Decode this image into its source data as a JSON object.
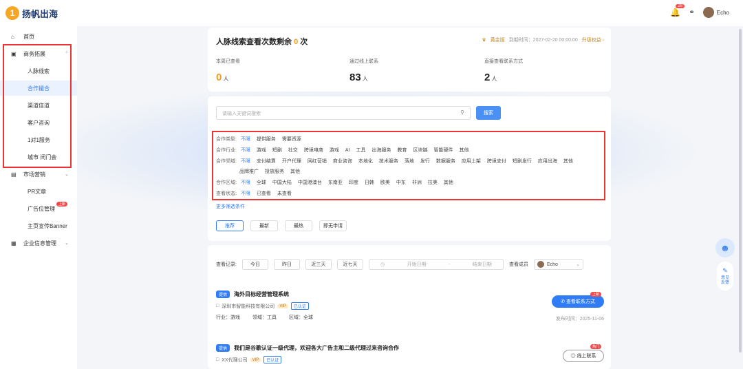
{
  "app": {
    "logo_mark": "1",
    "name": "扬帆出海"
  },
  "topbar": {
    "bell_badge": "26",
    "user_name": "Echo"
  },
  "sidebar": {
    "home": "首页",
    "business": {
      "label": "商务拓展",
      "items": [
        "人脉线索",
        "合作撮合",
        "渠道信道",
        "客户咨询",
        "1对1服务",
        "城市 闭门会"
      ]
    },
    "market": {
      "label": "市场营销",
      "items": [
        "PR文章",
        "广告位管理",
        "主页宣传Banner"
      ],
      "ad_badge": "上新"
    },
    "enterprise": "企业信息管理"
  },
  "summary": {
    "title_prefix": "人脉线索查看次数剩余 ",
    "title_count": "0",
    "title_suffix": " 次",
    "vip_label": "黄金版",
    "expire": "到期时间：2027-02-20 00:00:00",
    "upgrade_link": "升级权益 ›",
    "stats": [
      {
        "caption": "本周已查看",
        "value": "0",
        "unit": "人"
      },
      {
        "caption": "通过线上联系",
        "value": "83",
        "unit": "人"
      },
      {
        "caption": "直接查看联系方式",
        "value": "2",
        "unit": "人"
      }
    ]
  },
  "filters": {
    "search_placeholder": "请输入关键词搜索",
    "search_button": "搜索",
    "rows": [
      {
        "key": "合作类型:",
        "options": [
          "不限",
          "提供服务",
          "需要资源"
        ]
      },
      {
        "key": "合作行业:",
        "options": [
          "不限",
          "游戏",
          "短剧",
          "社交",
          "跨境电商",
          "游戏",
          "AI",
          "工具",
          "出海服务",
          "教育",
          "区块链",
          "智能硬件",
          "其他"
        ]
      },
      {
        "key": "合作领域:",
        "options": [
          "不限",
          "支付结算",
          "开户代理",
          "网红营销",
          "商业咨询",
          "本地化",
          "技术服务",
          "落地",
          "发行",
          "数据服务",
          "应用上架",
          "跨境支付",
          "短剧发行",
          "应用出海",
          "其他"
        ]
      },
      {
        "key": "",
        "options": [
          "品牌推广",
          "投放服务",
          "其他"
        ]
      },
      {
        "key": "合作区域:",
        "options": [
          "不限",
          "全球",
          "中国大陆",
          "中国港澳台",
          "东南亚",
          "印度",
          "日韩",
          "欧美",
          "中东",
          "非洲",
          "拉美",
          "其他"
        ]
      },
      {
        "key": "查看状态:",
        "options": [
          "不限",
          "已查看",
          "未查看"
        ]
      }
    ],
    "more_conditions": "更多筛选条件",
    "sort_tabs": [
      "推荐",
      "最新",
      "最热",
      "即无申请"
    ]
  },
  "records": {
    "label": "查看记录:",
    "ranges": [
      "今日",
      "昨日",
      "近三天",
      "近七天"
    ],
    "start_date": "开始日期",
    "end_date": "结束日期",
    "member_label": "查看成员",
    "member_value": "Echo",
    "leads": [
      {
        "tag": "提供",
        "title": "海外目标经营管理系统",
        "company": "深圳市智能科技有限公司",
        "vip": "VIP",
        "auth": "已认证",
        "meta": [
          "行业：游戏",
          "领域：工具",
          "区域：全球"
        ],
        "button": "✆ 查看联系方式",
        "badge": "上新",
        "time": "发布时间：2025-11-06"
      },
      {
        "tag": "提供",
        "title": "我们是谷歌认证一级代理，欢迎各大广告主和二级代理过来咨询合作",
        "company": "XX代理公司",
        "vip": "VIP",
        "auth": "已认证",
        "meta": [],
        "button": "◎ 线上联系",
        "badge": "热门",
        "time": ""
      }
    ]
  },
  "float": {
    "feedback": "意见反馈"
  }
}
